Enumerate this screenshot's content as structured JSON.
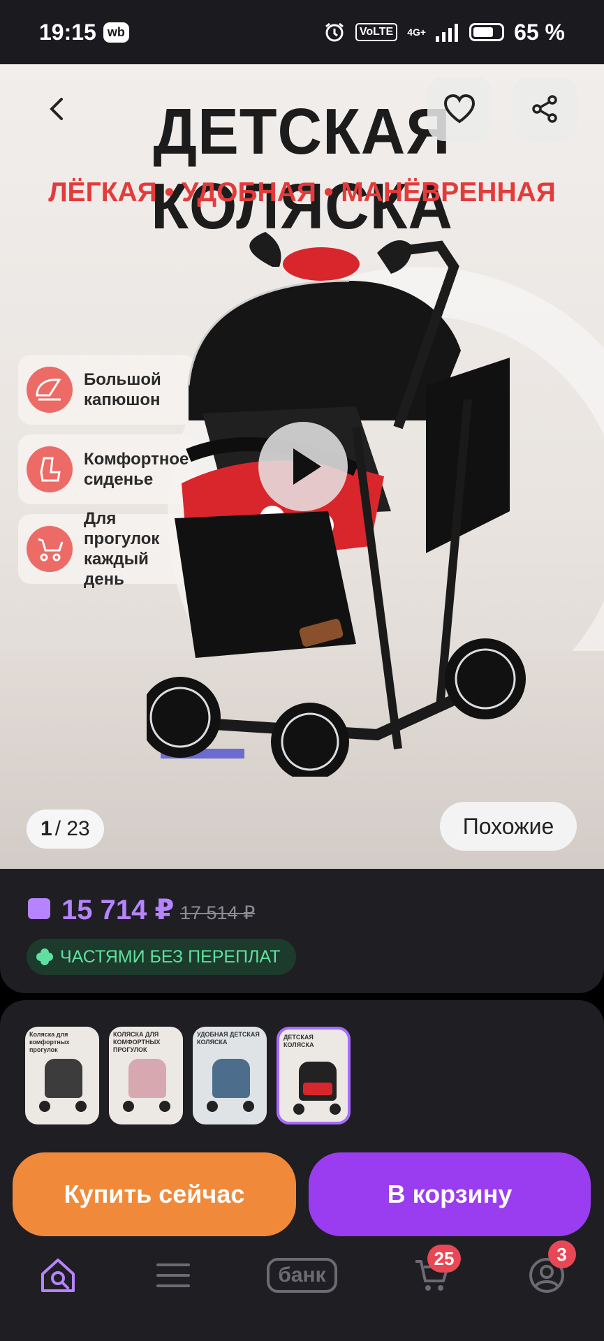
{
  "status_bar": {
    "time": "19:15",
    "app_badge": "wb",
    "volte": "VoLTE",
    "network": "4G+",
    "battery": "65 %"
  },
  "hero": {
    "title": "ДЕТСКАЯ КОЛЯСКА",
    "subtitle": "ЛЁГКАЯ • УДОБНАЯ • МАНЁВРЕННАЯ",
    "features": [
      {
        "label": "Большой капюшон",
        "icon": "hood-icon"
      },
      {
        "label": "Комфортное сиденье",
        "icon": "seat-icon"
      },
      {
        "label": "Для прогулок каждый день",
        "icon": "stroller-icon"
      }
    ],
    "counter_current": "1",
    "counter_total": "/ 23",
    "similar_button": "Похожие"
  },
  "price": {
    "current": "15 714 ₽",
    "old": "17 514 ₽",
    "installments": "ЧАСТЯМИ БЕЗ ПЕРЕПЛАТ"
  },
  "thumbnails": [
    {
      "caption": "Коляска для комфортных прогулок",
      "color": "#3c3c3c"
    },
    {
      "caption": "КОЛЯСКА ДЛЯ КОМФОРТНЫХ ПРОГУЛОК",
      "color": "#d7a8b0"
    },
    {
      "caption": "УДОБНАЯ ДЕТСКАЯ КОЛЯСКА",
      "color": "#4c6e8c"
    },
    {
      "caption": "ДЕТСКАЯ КОЛЯСКА",
      "color": "#222222"
    }
  ],
  "actions": {
    "buy_now": "Купить сейчас",
    "add_to_cart": "В корзину"
  },
  "nav": {
    "bank_label": "банк",
    "cart_badge": "25",
    "profile_badge": "3"
  },
  "colors": {
    "accent": "#b684ff",
    "buy": "#f08a3a",
    "cart": "#9a3cf0",
    "sale_red": "#e33b3b"
  }
}
